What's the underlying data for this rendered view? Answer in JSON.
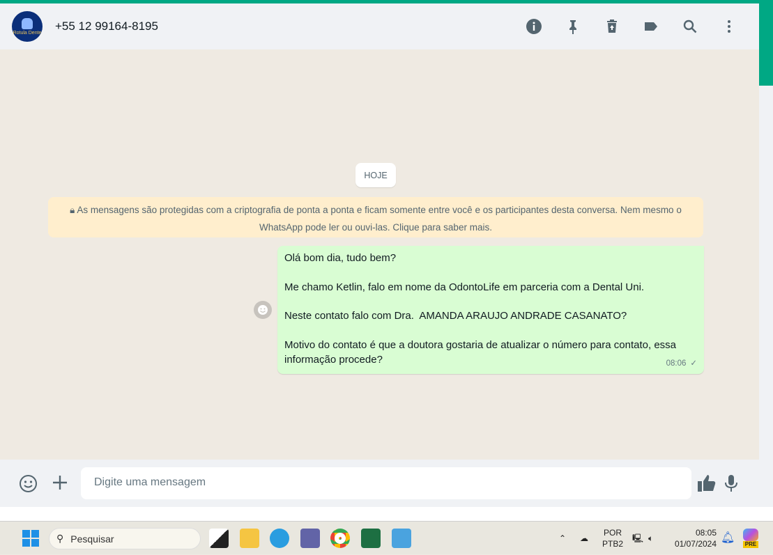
{
  "header": {
    "contact": "+55 12 99164-8195",
    "avatar_text": "Rotula Dente"
  },
  "chat": {
    "date_label": "HOJE",
    "encryption_notice": "As mensagens são protegidas com a criptografia de ponta a ponta e ficam somente entre você e os participantes desta conversa. Nem mesmo o WhatsApp pode ler ou ouvi-las. Clique para saber mais.",
    "messages": [
      {
        "lines": [
          "Olá bom dia, tudo bem?",
          "",
          "Me chamo Ketlin, falo em nome da OdontoLife em parceria com a Dental Uni.",
          "",
          "Neste contato falo com Dra.  AMANDA ARAUJO ANDRADE CASANATO?",
          "",
          "Motivo do contato é que a doutora gostaria de atualizar o número para contato, essa informação procede?"
        ],
        "text": "Olá bom dia, tudo bem?\n\nMe chamo Ketlin, falo em nome da OdontoLife em parceria com a Dental Uni.\n\nNeste contato falo com Dra.  AMANDA ARAUJO ANDRADE CASANATO?\n\nMotivo do contato é que a doutora gostaria de atualizar o número para contato, essa informação procede?",
        "time": "08:06",
        "status": "sent"
      }
    ]
  },
  "composer": {
    "placeholder": "Digite uma mensagem"
  },
  "taskbar": {
    "search_label": "Pesquisar",
    "lang_top": "POR",
    "lang_bottom": "PTB2",
    "time": "08:05",
    "date": "01/07/2024",
    "copilot_badge": "PRE"
  },
  "colors": {
    "accent": "#00a884",
    "bubble": "#d9fdd3",
    "notice": "#ffeecd"
  }
}
